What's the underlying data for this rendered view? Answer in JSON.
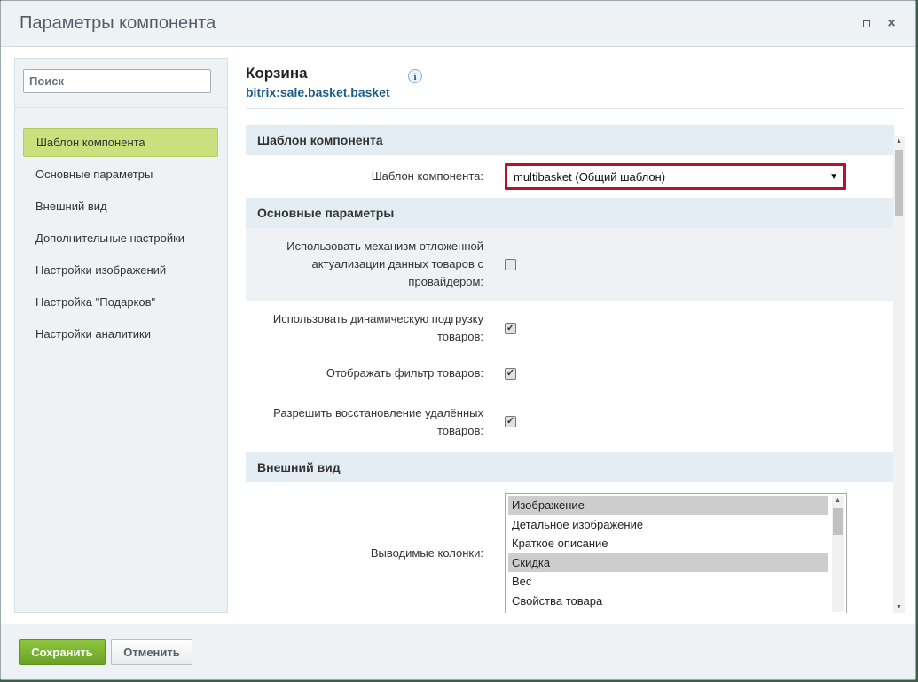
{
  "window": {
    "title": "Параметры компонента"
  },
  "sidebar": {
    "search_placeholder": "Поиск",
    "items": [
      {
        "label": "Шаблон компонента",
        "active": true
      },
      {
        "label": "Основные параметры"
      },
      {
        "label": "Внешний вид"
      },
      {
        "label": "Дополнительные настройки"
      },
      {
        "label": "Настройки изображений"
      },
      {
        "label": "Настройка \"Подарков\""
      },
      {
        "label": "Настройки аналитики"
      }
    ]
  },
  "component": {
    "title": "Корзина",
    "code": "bitrix:sale.basket.basket",
    "info_icon_glyph": "i"
  },
  "sections": {
    "template": {
      "heading": "Шаблон компонента",
      "field_label": "Шаблон компонента:",
      "selected_value": "multibasket (Общий шаблон)"
    },
    "main": {
      "heading": "Основные параметры",
      "fields": [
        {
          "label": "Использовать механизм отложенной актуализации данных товаров с провайдером:",
          "checked": false
        },
        {
          "label": "Использовать динамическую подгрузку товаров:",
          "checked": true
        },
        {
          "label": "Отображать фильтр товаров:",
          "checked": true
        },
        {
          "label": "Разрешить восстановление удалённых товаров:",
          "checked": true
        }
      ]
    },
    "appearance": {
      "heading": "Внешний вид",
      "columns_label": "Выводимые колонки:",
      "columns_options": [
        {
          "label": "Изображение",
          "selected": true
        },
        {
          "label": "Детальное изображение",
          "selected": false
        },
        {
          "label": "Краткое описание",
          "selected": false
        },
        {
          "label": "Скидка",
          "selected": true
        },
        {
          "label": "Вес",
          "selected": false
        },
        {
          "label": "Свойства товара",
          "selected": false
        }
      ]
    }
  },
  "footer": {
    "save_label": "Сохранить",
    "cancel_label": "Отменить"
  },
  "colors": {
    "active_nav": "#c9e07d",
    "section_header": "#e4edf3",
    "select_border": "#b5122e",
    "save_button": "#7cb632",
    "link_code": "#1f5c8c"
  }
}
